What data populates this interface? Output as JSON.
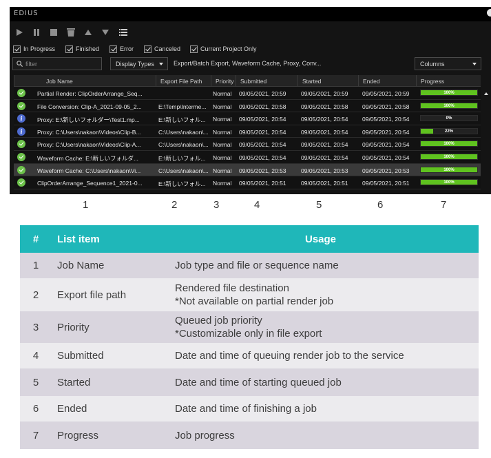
{
  "window": {
    "title": "EDIUS"
  },
  "toolbar": {
    "icons": [
      "play-icon",
      "pause-icon",
      "stop-icon",
      "delete-icon",
      "move-up-icon",
      "move-down-icon",
      "list-icon"
    ]
  },
  "filters": [
    {
      "label": "In Progress",
      "checked": true
    },
    {
      "label": "Finished",
      "checked": true
    },
    {
      "label": "Error",
      "checked": true
    },
    {
      "label": "Canceled",
      "checked": true
    },
    {
      "label": "Current Project Only",
      "checked": true
    }
  ],
  "search": {
    "placeholder": "filter"
  },
  "display_types": {
    "label": "Display Types",
    "summary": "Export/Batch Export, Waveform Cache, Proxy, Conv..."
  },
  "columns_dropdown": {
    "label": "Columns"
  },
  "grid": {
    "headers": [
      "Job Name",
      "Export File Path",
      "Priority",
      "Submitted",
      "Started",
      "Ended",
      "Progress"
    ],
    "rows": [
      {
        "status": "ok",
        "job": "Partial Render: ClipOrderArrange_Seq...",
        "path": "",
        "priority": "Normal",
        "submitted": "09/05/2021, 20:59",
        "started": "09/05/2021, 20:59",
        "ended": "09/05/2021, 20:59",
        "progress": 1.0,
        "progress_label": "100%",
        "selected": false
      },
      {
        "status": "ok",
        "job": "File Conversion: Clip-A_2021-09-05_2...",
        "path": "E:\\Temp\\Interme...",
        "priority": "Normal",
        "submitted": "09/05/2021, 20:58",
        "started": "09/05/2021, 20:58",
        "ended": "09/05/2021, 20:58",
        "progress": 1.0,
        "progress_label": "100%",
        "selected": false
      },
      {
        "status": "info",
        "job": "Proxy: E:\\新しいフォルダー\\Test1.mp...",
        "path": "E:\\新しいフォル...",
        "priority": "Normal",
        "submitted": "09/05/2021, 20:54",
        "started": "09/05/2021, 20:54",
        "ended": "09/05/2021, 20:54",
        "progress": 0.0,
        "progress_label": "0%",
        "selected": false
      },
      {
        "status": "info",
        "job": "Proxy: C:\\Users\\nakaon\\Videos\\Clip-B...",
        "path": "C:\\Users\\nakaon\\...",
        "priority": "Normal",
        "submitted": "09/05/2021, 20:54",
        "started": "09/05/2021, 20:54",
        "ended": "09/05/2021, 20:54",
        "progress": 0.22,
        "progress_label": "22%",
        "selected": false
      },
      {
        "status": "ok",
        "job": "Proxy: C:\\Users\\nakaon\\Videos\\Clip-A...",
        "path": "C:\\Users\\nakaon\\...",
        "priority": "Normal",
        "submitted": "09/05/2021, 20:54",
        "started": "09/05/2021, 20:54",
        "ended": "09/05/2021, 20:54",
        "progress": 1.0,
        "progress_label": "100%",
        "selected": false
      },
      {
        "status": "ok",
        "job": "Waveform Cache: E:\\新しいフォルダ...",
        "path": "E:\\新しいフォル...",
        "priority": "Normal",
        "submitted": "09/05/2021, 20:54",
        "started": "09/05/2021, 20:54",
        "ended": "09/05/2021, 20:54",
        "progress": 1.0,
        "progress_label": "100%",
        "selected": false
      },
      {
        "status": "ok",
        "job": "Waveform Cache: C:\\Users\\nakaon\\Vi...",
        "path": "C:\\Users\\nakaon\\...",
        "priority": "Normal",
        "submitted": "09/05/2021, 20:53",
        "started": "09/05/2021, 20:53",
        "ended": "09/05/2021, 20:53",
        "progress": 1.0,
        "progress_label": "100%",
        "selected": true
      },
      {
        "status": "ok",
        "job": "ClipOrderArrange_Sequence1_2021-0...",
        "path": "E:\\新しいフォル...",
        "priority": "Normal",
        "submitted": "09/05/2021, 20:51",
        "started": "09/05/2021, 20:51",
        "ended": "09/05/2021, 20:51",
        "progress": 1.0,
        "progress_label": "100%",
        "selected": false
      }
    ]
  },
  "column_numbers": [
    "1",
    "2",
    "3",
    "4",
    "5",
    "6",
    "7"
  ],
  "reference_table": {
    "headers": [
      "#",
      "List item",
      "Usage"
    ],
    "rows": [
      {
        "num": "1",
        "item": "Job Name",
        "usage": [
          "Job type and file or sequence name"
        ]
      },
      {
        "num": "2",
        "item": "Export file path",
        "usage": [
          "Rendered file destination",
          "*Not available on partial render job"
        ]
      },
      {
        "num": "3",
        "item": "Priority",
        "usage": [
          "Queued job priority",
          "*Customizable only in file export"
        ]
      },
      {
        "num": "4",
        "item": "Submitted",
        "usage": [
          "Date and time of queuing render job to the service"
        ]
      },
      {
        "num": "5",
        "item": "Started",
        "usage": [
          "Date and time of starting queued job"
        ]
      },
      {
        "num": "6",
        "item": "Ended",
        "usage": [
          "Date and time of finishing a job"
        ]
      },
      {
        "num": "7",
        "item": "Progress",
        "usage": [
          "Job progress"
        ]
      }
    ]
  },
  "colors": {
    "accent": "#1fb7b9",
    "progress": "#5fc21f",
    "ok": "#6cc24a",
    "info": "#4e6bd0"
  }
}
